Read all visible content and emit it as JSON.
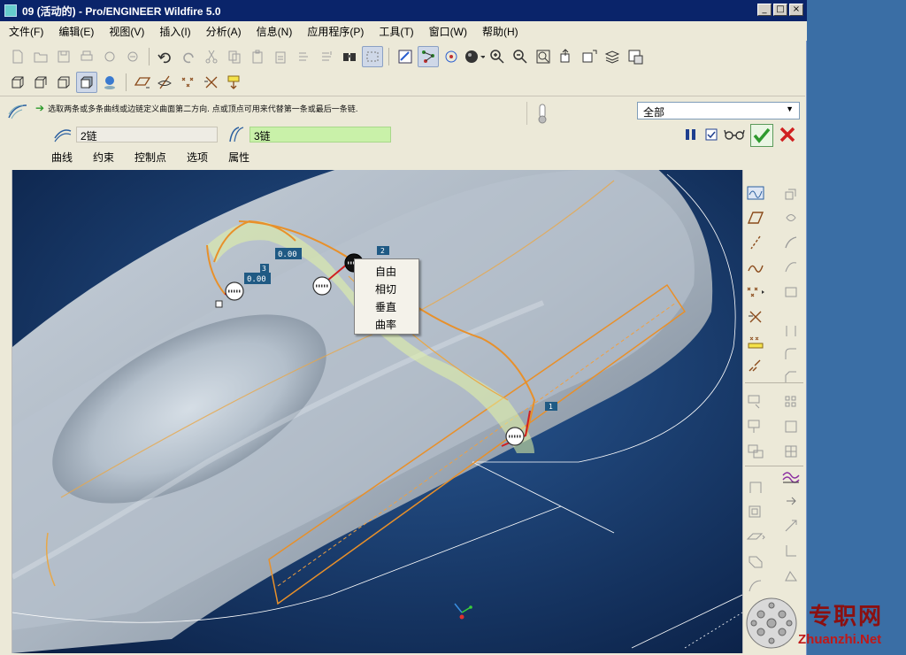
{
  "window": {
    "title": "09 (活动的) - Pro/ENGINEER Wildfire 5.0",
    "controls": {
      "minimize": "_",
      "maximize": "□",
      "close": "×"
    }
  },
  "menubar": {
    "items": [
      "文件(F)",
      "编辑(E)",
      "视图(V)",
      "插入(I)",
      "分析(A)",
      "信息(N)",
      "应用程序(P)",
      "工具(T)",
      "窗口(W)",
      "帮助(H)"
    ]
  },
  "dashboard": {
    "prompt": "选取两条或多条曲线或边链定义曲面第二方向. 点或顶点可用来代替第一条或最后一条链.",
    "filter": {
      "selected": "全部"
    },
    "first_direction": {
      "value": "2链"
    },
    "second_direction": {
      "value": "3链"
    },
    "tabs": [
      "曲线",
      "约束",
      "控制点",
      "选项",
      "属性"
    ]
  },
  "viewport": {
    "dimension_labels": [
      "0.00",
      "0.00"
    ],
    "chain_tags": [
      "3",
      "2",
      "1"
    ]
  },
  "context_menu": {
    "items": [
      "自由",
      "相切",
      "垂直",
      "曲率"
    ]
  },
  "watermark": {
    "title": "专职网",
    "url": "Zhuanzhi.Net"
  },
  "icons": {
    "toolbar_row1": [
      "new-icon",
      "open-icon",
      "save-icon",
      "print-icon",
      "send-icon",
      "email-icon",
      "undo-icon",
      "redo-icon",
      "cut-icon",
      "copy-icon",
      "paste-icon",
      "paste-special-icon",
      "regenerate-icon",
      "regen-manager-icon",
      "find-icon",
      "select-box-icon",
      "repaint-icon",
      "datum-display-icon",
      "spin-center-icon",
      "shading-icon",
      "zoom-in-icon",
      "zoom-out-icon",
      "refit-icon",
      "reorient-icon",
      "saved-views-icon",
      "layers-icon",
      "view-manager-icon"
    ],
    "toolbar_row2": [
      "wireframe-icon",
      "hidden-line-icon",
      "no-hidden-icon",
      "shaded-icon",
      "enhanced-realism-icon",
      "datum-planes-icon",
      "datum-axes-icon",
      "datum-points-icon",
      "coord-sys-icon",
      "annotation-icon"
    ],
    "colors": {
      "titlebar": "#0a246a",
      "viewport_bg": "#0e2b57",
      "chain_highlight": "#c9f1a9",
      "ok_green": "#2e9a2e",
      "cancel_red": "#d02020"
    }
  }
}
